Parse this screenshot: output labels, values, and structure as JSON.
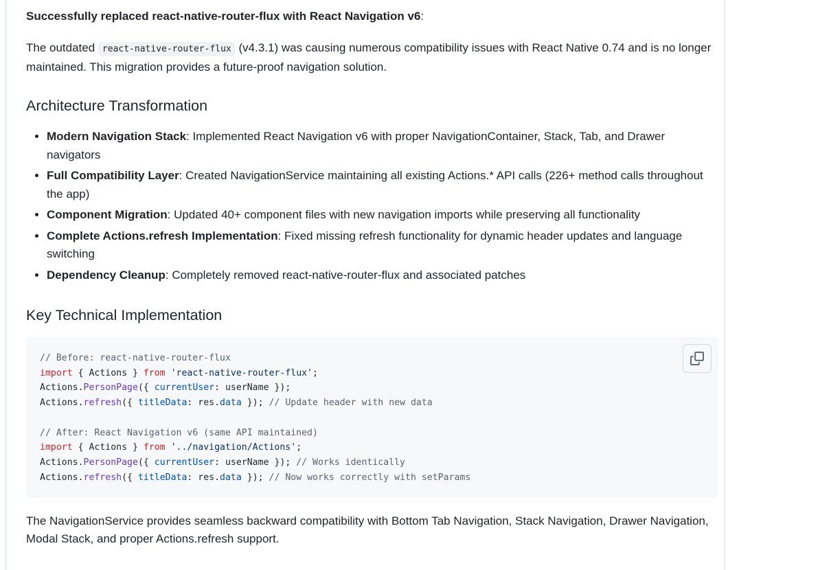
{
  "intro": {
    "strong": "Successfully replaced react-native-router-flux with React Navigation v6",
    "suffix": ":"
  },
  "paragraph1": {
    "before": "The outdated ",
    "code": "react-native-router-flux",
    "after": " (v4.3.1) was causing numerous compatibility issues with React Native 0.74 and is no longer maintained. This migration provides a future-proof navigation solution."
  },
  "section1": {
    "heading": "Architecture Transformation",
    "items": [
      {
        "label": "Modern Navigation Stack",
        "text": ": Implemented React Navigation v6 with proper NavigationContainer, Stack, Tab, and Drawer navigators"
      },
      {
        "label": "Full Compatibility Layer",
        "text": ": Created NavigationService maintaining all existing Actions.* API calls (226+ method calls throughout the app)"
      },
      {
        "label": "Component Migration",
        "text": ": Updated 40+ component files with new navigation imports while preserving all functionality"
      },
      {
        "label": "Complete Actions.refresh Implementation",
        "text": ": Fixed missing refresh functionality for dynamic header updates and language switching"
      },
      {
        "label": "Dependency Cleanup",
        "text": ": Completely removed react-native-router-flux and associated patches"
      }
    ]
  },
  "section2": {
    "heading": "Key Technical Implementation"
  },
  "code": {
    "before_comment": "// Before: react-native-router-flux",
    "import_kw": "import",
    "import_body": " { Actions } ",
    "from_kw": "from",
    "before_module": "'react-native-router-flux'",
    "semicolon": ";",
    "actions": "Actions",
    "dot": ".",
    "person_page": "PersonPage",
    "open_brace": "({ ",
    "current_user": "currentUser",
    "colon_user": ": userName });",
    "refresh": "refresh",
    "title_data": "titleData",
    "colon_res": ": res.",
    "data_prop": "data",
    "close": " });",
    "before_refresh_comment": " // Update header with new data",
    "after_comment": "// After: React Navigation v6 (same API maintained)",
    "after_module": "'../navigation/Actions'",
    "works_comment": " // Works identically",
    "setparams_comment": " // Now works correctly with setParams"
  },
  "copy_icon": "copy-icon",
  "paragraph_final": {
    "text": "The NavigationService provides seamless backward compatibility with Bottom Tab Navigation, Stack Navigation, Drawer Navigation, Modal Stack, and proper Actions.refresh support."
  },
  "colors": {
    "text": "#1f2328",
    "comment": "#59636e",
    "keyword": "#cf222e",
    "string": "#0a3069",
    "function": "#6639ba",
    "property": "#0550ae",
    "code_bg": "#f6f8fa"
  }
}
